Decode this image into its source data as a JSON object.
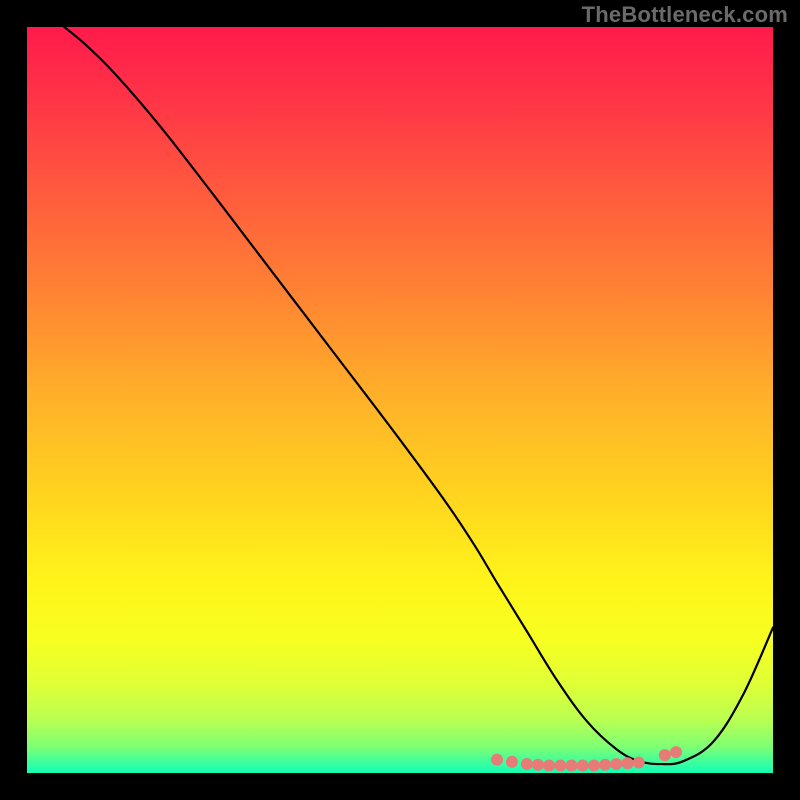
{
  "watermark": "TheBottleneck.com",
  "gradient": {
    "stops": [
      {
        "offset": 0.0,
        "color": "#ff1a4b"
      },
      {
        "offset": 0.1,
        "color": "#ff3547"
      },
      {
        "offset": 0.22,
        "color": "#ff5a3e"
      },
      {
        "offset": 0.36,
        "color": "#ff8433"
      },
      {
        "offset": 0.5,
        "color": "#ffb229"
      },
      {
        "offset": 0.62,
        "color": "#ffd21f"
      },
      {
        "offset": 0.74,
        "color": "#fff31a"
      },
      {
        "offset": 0.82,
        "color": "#f7ff20"
      },
      {
        "offset": 0.88,
        "color": "#e0ff36"
      },
      {
        "offset": 0.93,
        "color": "#b8ff52"
      },
      {
        "offset": 0.965,
        "color": "#7eff74"
      },
      {
        "offset": 0.985,
        "color": "#3eff9d"
      },
      {
        "offset": 1.0,
        "color": "#12ffb6"
      }
    ]
  },
  "chart_data": {
    "type": "line",
    "title": "",
    "xlabel": "",
    "ylabel": "",
    "xlim": [
      0,
      100
    ],
    "ylim": [
      0,
      100
    ],
    "series": [
      {
        "name": "curve",
        "x": [
          5,
          8,
          12,
          18,
          25,
          33,
          41,
          49,
          56,
          60,
          63,
          67,
          71,
          75,
          79,
          82,
          85,
          88,
          92,
          96,
          100
        ],
        "y": [
          100,
          97.5,
          93.5,
          86.5,
          77.5,
          67,
          56.5,
          46,
          36.5,
          30.5,
          25.5,
          19,
          12.5,
          7,
          3.2,
          1.6,
          1.2,
          1.6,
          4.2,
          10.5,
          19.5
        ]
      }
    ],
    "markers": {
      "name": "bottom-dots",
      "x": [
        63,
        65,
        67,
        68.5,
        70,
        71.5,
        73,
        74.5,
        76,
        77.5,
        79,
        80.5,
        82,
        85.5,
        87
      ],
      "y": [
        1.8,
        1.5,
        1.2,
        1.1,
        1.0,
        1.0,
        1.0,
        1.0,
        1.0,
        1.1,
        1.2,
        1.3,
        1.4,
        2.4,
        2.8
      ]
    }
  },
  "style": {
    "plot_bg": "gradient",
    "frame_color": "#000000",
    "curve_color": "#000000",
    "curve_width": 2.2,
    "marker_color": "#e67b78",
    "marker_radius": 6
  }
}
